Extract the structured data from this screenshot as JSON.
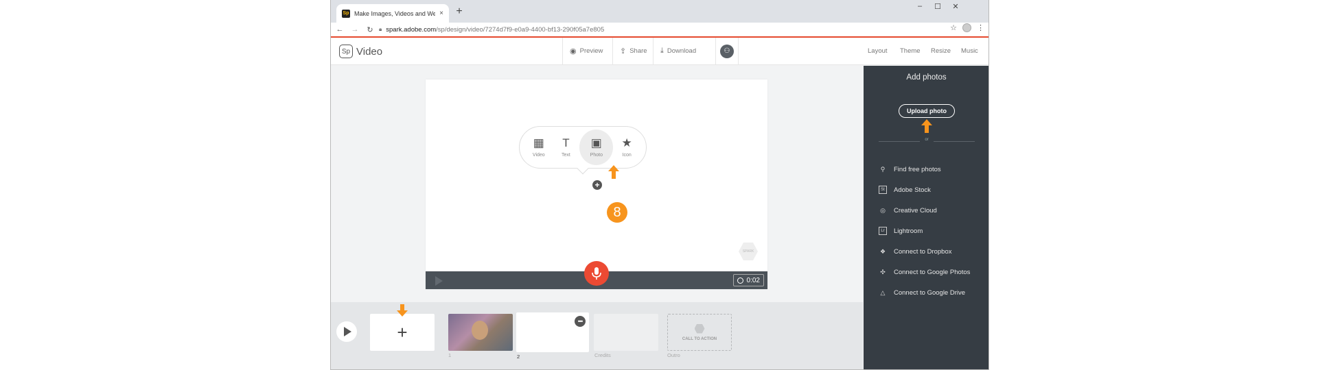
{
  "browser": {
    "tab_title": "Make Images, Videos and Web S",
    "tab_close": "×",
    "new_tab": "+",
    "url_domain": "spark.adobe.com",
    "url_path": "/sp/design/video/7274d7f9-e0a9-4400-bf13-290f05a7e805",
    "favicon_text": "Sp",
    "window_controls": [
      "–",
      "☐",
      "✕"
    ]
  },
  "app": {
    "logo_mark": "Sp",
    "name": "Video",
    "header_buttons": [
      {
        "label": "Preview",
        "icon": "eye-icon"
      },
      {
        "label": "Share",
        "icon": "share-icon"
      },
      {
        "label": "Download",
        "icon": "download-icon"
      }
    ],
    "right_links": [
      "Layout",
      "Theme",
      "Resize",
      "Music"
    ]
  },
  "canvas": {
    "insert_options": [
      {
        "label": "Video",
        "icon": "film-icon",
        "glyph": "▦"
      },
      {
        "label": "Text",
        "icon": "text-icon",
        "glyph": "T"
      },
      {
        "label": "Photo",
        "icon": "photo-icon",
        "glyph": "▣"
      },
      {
        "label": "Icon",
        "icon": "star-icon",
        "glyph": "★"
      }
    ],
    "selected_option": "Photo",
    "add_symbol": "+",
    "step_number": "8",
    "duration": "0:02",
    "watermark_text": "SPARK"
  },
  "timeline": {
    "add_symbol": "+",
    "slides": [
      {
        "label": "1"
      },
      {
        "label": "2"
      },
      {
        "label": "Credits"
      },
      {
        "label": "Outro"
      }
    ],
    "outro_text": "CALL TO ACTION",
    "more_symbol": "•••"
  },
  "panel": {
    "title": "Add photos",
    "upload_button": "Upload photo",
    "divider_text": "or",
    "sources": [
      {
        "label": "Find free photos",
        "icon": "search-icon",
        "glyph": "⚲"
      },
      {
        "label": "Adobe Stock",
        "icon": "adobe-stock-icon",
        "glyph": "St"
      },
      {
        "label": "Creative Cloud",
        "icon": "creative-cloud-icon",
        "glyph": "◎"
      },
      {
        "label": "Lightroom",
        "icon": "lightroom-icon",
        "glyph": "Lr"
      },
      {
        "label": "Connect to Dropbox",
        "icon": "dropbox-icon",
        "glyph": "❖"
      },
      {
        "label": "Connect to Google Photos",
        "icon": "google-photos-icon",
        "glyph": "✣"
      },
      {
        "label": "Connect to Google Drive",
        "icon": "google-drive-icon",
        "glyph": "△"
      }
    ]
  },
  "colors": {
    "accent_red": "#e5492d",
    "mic_red": "#ec4a33",
    "callout_orange": "#f7941d",
    "panel_bg": "#363d44"
  }
}
